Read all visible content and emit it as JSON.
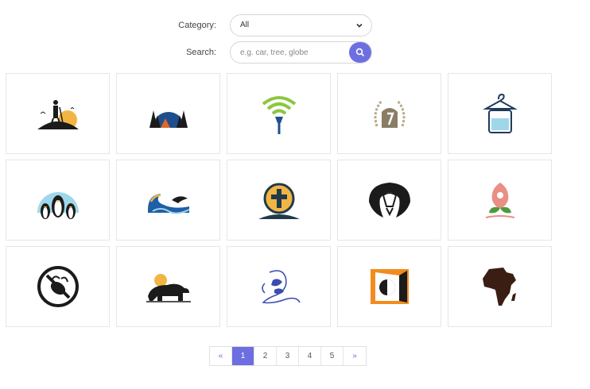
{
  "filters": {
    "category_label": "Category:",
    "category_value": "All",
    "search_label": "Search:",
    "search_placeholder": "e.g. car, tree, globe"
  },
  "logos": [
    {
      "icon": "hiker-on-hill-icon"
    },
    {
      "icon": "forest-night-icon"
    },
    {
      "icon": "wifi-torch-icon"
    },
    {
      "icon": "laurel-number-seven-icon"
    },
    {
      "icon": "hanger-jar-icon"
    },
    {
      "icon": "penguins-icon"
    },
    {
      "icon": "wave-dolphin-icon"
    },
    {
      "icon": "church-cross-icon"
    },
    {
      "icon": "cobra-head-icon"
    },
    {
      "icon": "flower-bud-icon"
    },
    {
      "icon": "no-bee-icon"
    },
    {
      "icon": "bear-sun-icon"
    },
    {
      "icon": "line-fish-icon"
    },
    {
      "icon": "door-half-circle-icon"
    },
    {
      "icon": "africa-map-icon"
    }
  ],
  "pagination": {
    "prev": "«",
    "pages": [
      "1",
      "2",
      "3",
      "4",
      "5"
    ],
    "active": "1",
    "next": "»"
  },
  "colors": {
    "accent": "#6d6ee0",
    "border": "#e6e6e6"
  }
}
